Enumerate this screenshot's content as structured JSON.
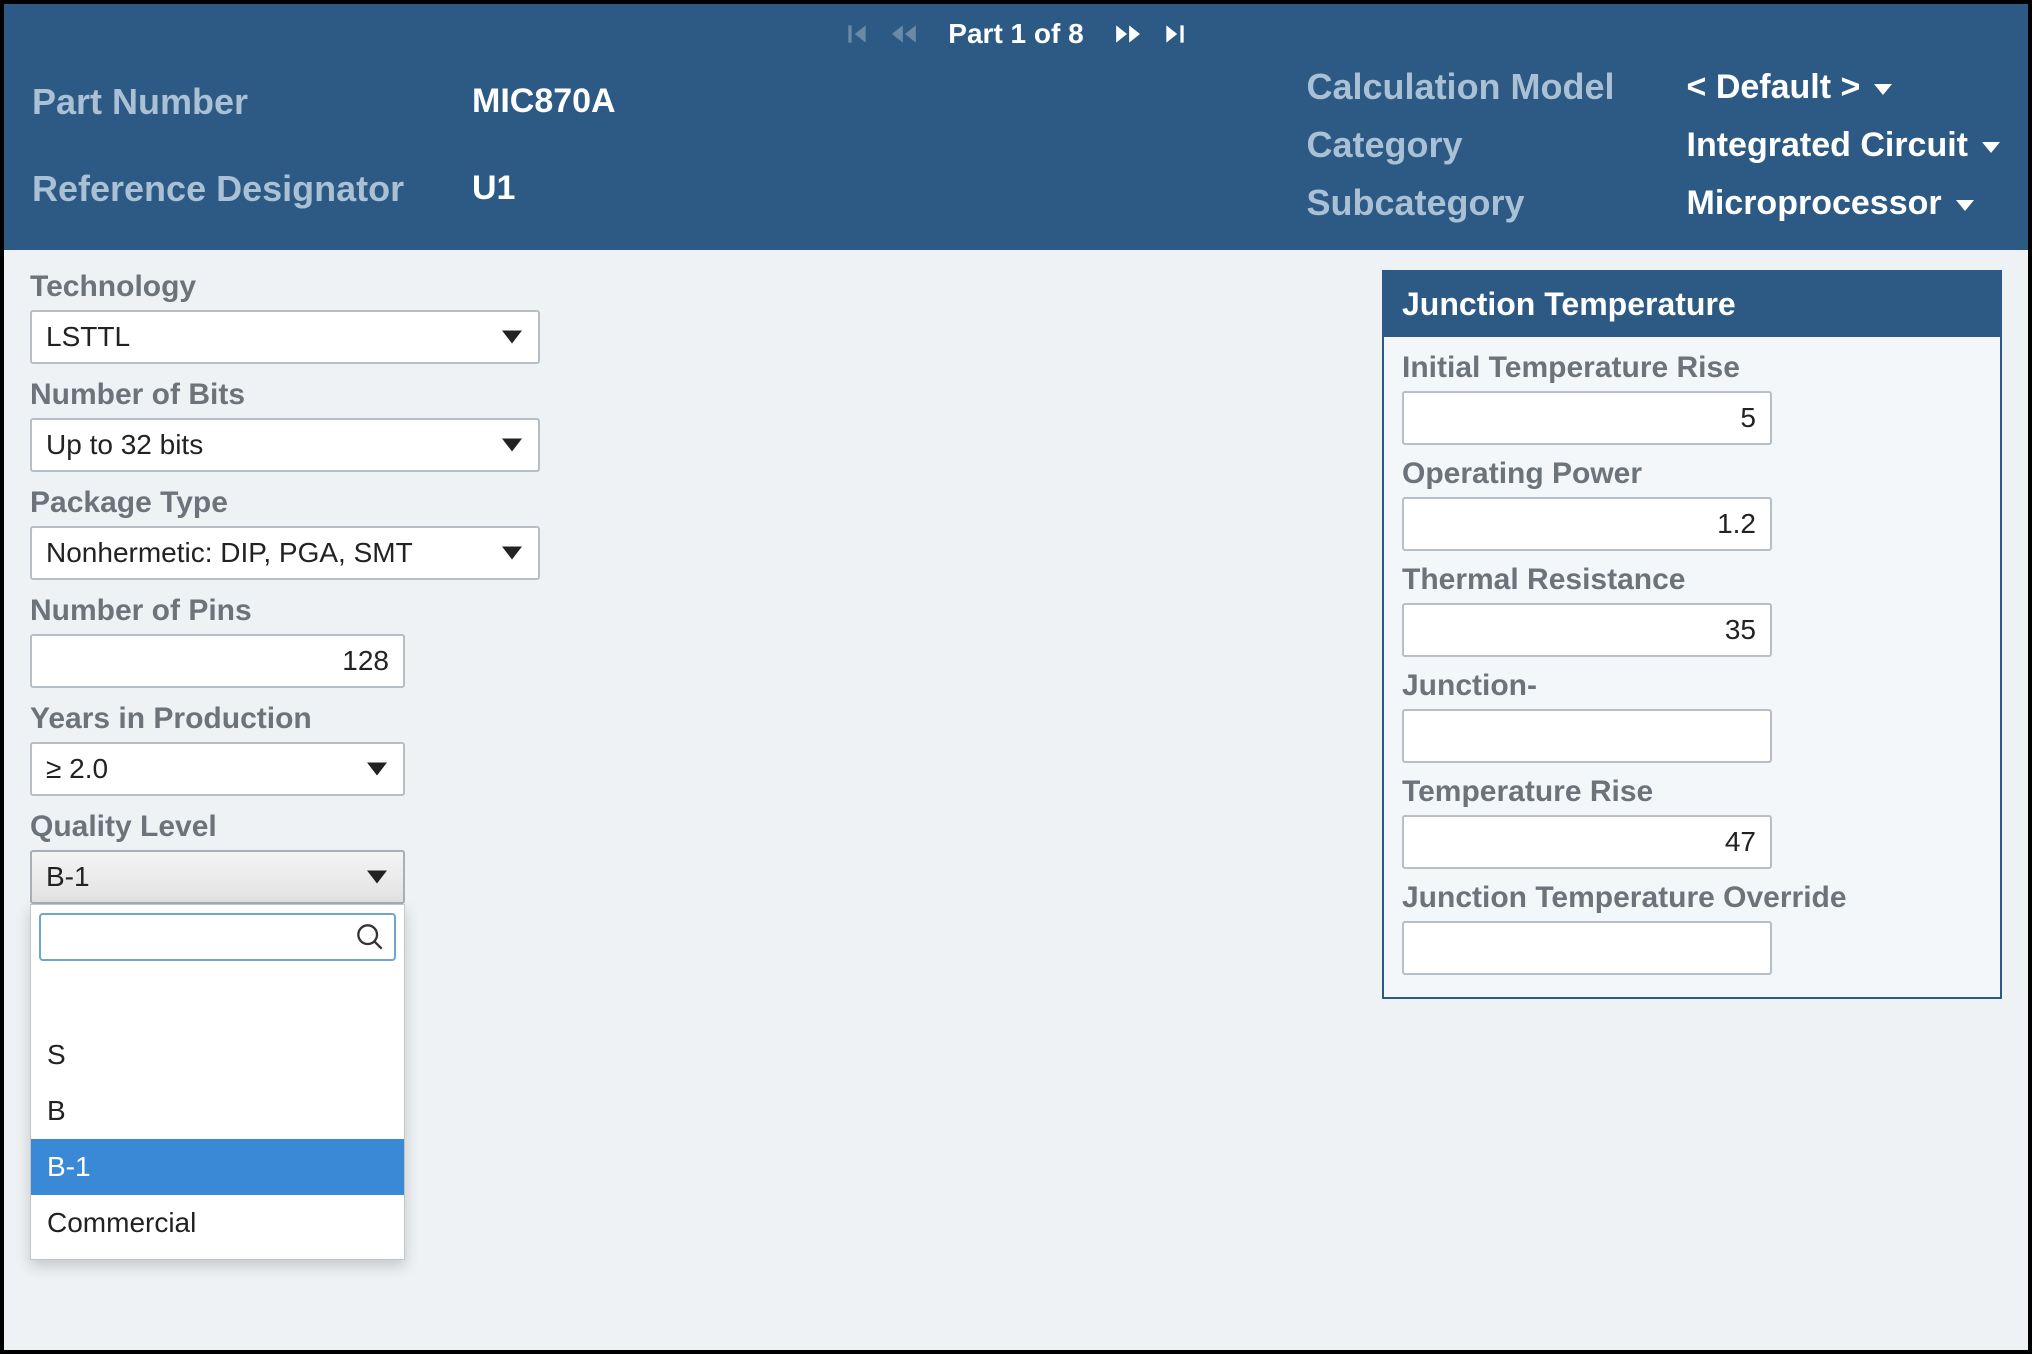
{
  "pager": {
    "label": "Part 1 of 8"
  },
  "header": {
    "left": {
      "part_number_label": "Part Number",
      "part_number_value": "MIC870A",
      "ref_des_label": "Reference Designator",
      "ref_des_value": "U1"
    },
    "right": {
      "calc_model_label": "Calculation Model",
      "calc_model_value": "< Default >",
      "category_label": "Category",
      "category_value": "Integrated Circuit",
      "subcategory_label": "Subcategory",
      "subcategory_value": "Microprocessor"
    }
  },
  "form": {
    "technology": {
      "label": "Technology",
      "value": "LSTTL"
    },
    "num_bits": {
      "label": "Number of Bits",
      "value": "Up to 32 bits"
    },
    "package_type": {
      "label": "Package Type",
      "value": "Nonhermetic: DIP, PGA, SMT"
    },
    "num_pins": {
      "label": "Number of Pins",
      "value": "128"
    },
    "years_prod": {
      "label": "Years in Production",
      "value": "≥ 2.0"
    },
    "quality": {
      "label": "Quality Level",
      "value": "B-1",
      "options": [
        "",
        "S",
        "B",
        "B-1",
        "Commercial"
      ],
      "selected_index": 3
    }
  },
  "junction": {
    "title": "Junction Temperature",
    "initial_rise": {
      "label": "Initial Temperature Rise",
      "value": "5"
    },
    "op_power": {
      "label": "Operating Power",
      "value": "1.2"
    },
    "thermal_res": {
      "label": "Thermal Resistance",
      "value": "35"
    },
    "junction": {
      "label": "Junction-",
      "value": ""
    },
    "temp_rise": {
      "label": "Temperature Rise",
      "value": "47"
    },
    "override": {
      "label": "Junction Temperature Override",
      "value": ""
    }
  }
}
